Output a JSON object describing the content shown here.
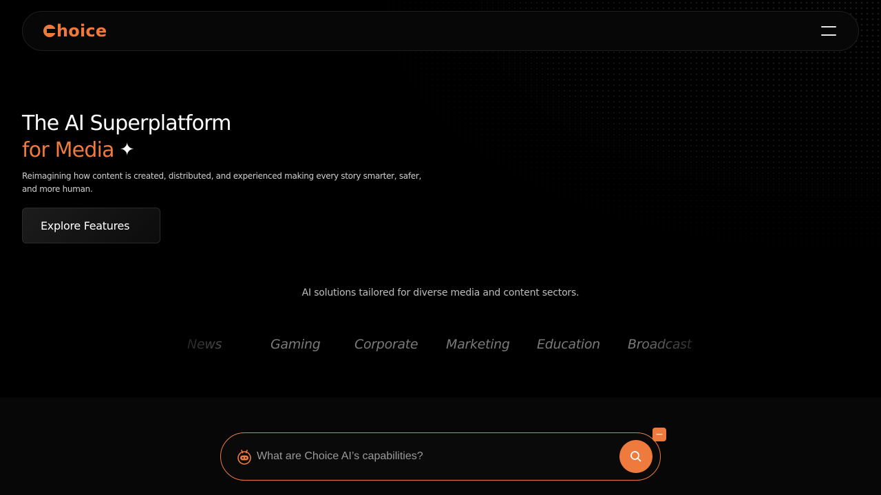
{
  "nav": {
    "logo_text": "hoice",
    "menu_icon": "hamburger-menu-icon"
  },
  "hero": {
    "title_line1": "The AI Superplatform",
    "title_line2": "for Media",
    "sparkle": "✦",
    "description": "Reimagining how content is created, distributed, and experienced making every story smarter, safer, and more human.",
    "cta_label": "Explore Features"
  },
  "sectors": {
    "caption": "AI solutions tailored for diverse media and content sectors.",
    "items": [
      "News",
      "Gaming",
      "Corporate",
      "Marketing",
      "Education",
      "Broadcast"
    ]
  },
  "chat": {
    "placeholder": "What are Choice AI’s capabilities?",
    "bot_icon": "robot-icon",
    "search_icon": "search-icon",
    "minimize_label": "−"
  },
  "colors": {
    "accent": "#ef7a3d",
    "background": "#000000",
    "muted_text": "#7a7a7a"
  }
}
